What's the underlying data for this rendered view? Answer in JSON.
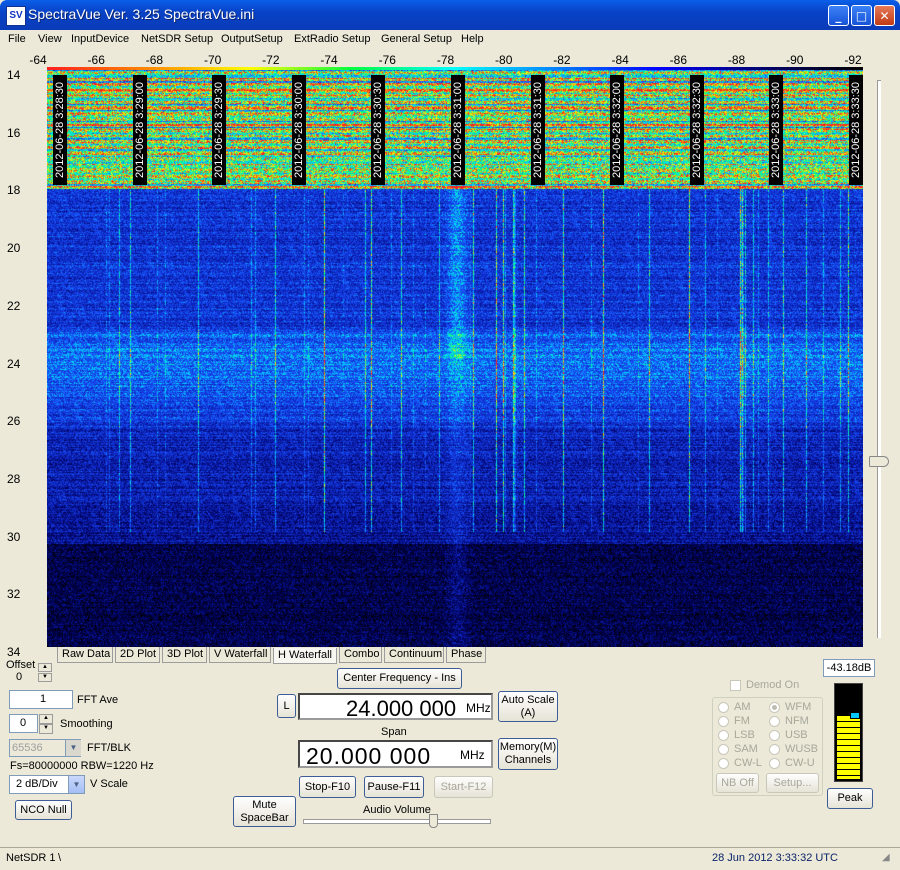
{
  "window": {
    "title": "SpectraVue Ver. 3.25  SpectraVue.ini",
    "icon_text": "SV",
    "controls": {
      "minimize": "_",
      "maximize": "□",
      "close": "✕"
    }
  },
  "menu": [
    "File",
    "View",
    "InputDevice",
    "NetSDR Setup",
    "OutputSetup",
    "ExtRadio Setup",
    "General Setup",
    "Help"
  ],
  "waterfall": {
    "x_ticks": [
      "-64",
      "-66",
      "-68",
      "-70",
      "-72",
      "-74",
      "-76",
      "-78",
      "-80",
      "-82",
      "-84",
      "-86",
      "-88",
      "-90",
      "-92"
    ],
    "y_ticks": [
      "14",
      "16",
      "18",
      "20",
      "22",
      "24",
      "26",
      "28",
      "30",
      "32",
      "34"
    ],
    "timestamps": [
      "2012-06-28 3:28:30",
      "2012-06-28 3:29:00",
      "2012-06-28 3:29:30",
      "2012-06-28 3:30:00",
      "2012-06-28 3:30:30",
      "2012-06-28 3:31:00",
      "2012-06-28 3:31:30",
      "2012-06-28 3:32:00",
      "2012-06-28 3:32:30",
      "2012-06-28 3:33:00",
      "2012-06-28 3:33:30"
    ],
    "colors": {
      "background": "#0A1E8C",
      "hot": "#FF2020",
      "warm": "#FFE000",
      "mid": "#00E6FF"
    }
  },
  "tabs": [
    "Raw Data",
    "2D Plot",
    "3D Plot",
    "V Waterfall",
    "H Waterfall",
    "Combo",
    "Continuum",
    "Phase"
  ],
  "active_tab": "H Waterfall",
  "left_panel": {
    "offset_label": "Offset",
    "offset_value": "0",
    "fft_ave_value": "1",
    "fft_ave_label": "FFT Ave",
    "smoothing_value": "0",
    "smoothing_label": "Smoothing",
    "fft_blk_value": "65536",
    "fft_blk_label": "FFT/BLK",
    "fs_rbw": "Fs=80000000 RBW=1220 Hz",
    "vscale_value": "2 dB/Div",
    "vscale_label": "V Scale",
    "nco_null": "NCO Null"
  },
  "center_panel": {
    "center_freq_button": "Center Frequency - Ins",
    "l_button": "L",
    "center_freq_value": "24.000 000",
    "center_freq_unit": "MHz",
    "auto_scale": "Auto Scale\n(A)",
    "span_label": "Span",
    "span_value": "20.000 000",
    "span_unit": "MHz",
    "memory_channels": "Memory(M)\nChannels",
    "mute": "Mute\nSpaceBar",
    "stop": "Stop-F10",
    "pause": "Pause-F11",
    "start": "Start-F12",
    "audio_volume_label": "Audio Volume",
    "audio_volume_level": 0.7
  },
  "demod_panel": {
    "demod_on_label": "Demod On",
    "modes_left": [
      "AM",
      "FM",
      "LSB",
      "SAM",
      "CW-L"
    ],
    "modes_right": [
      "WFM",
      "NFM",
      "USB",
      "WUSB",
      "CW-U"
    ],
    "selected_mode": "WFM",
    "nb_off": "NB Off",
    "setup": "Setup..."
  },
  "meter": {
    "level_text": "-43.18dB",
    "peak": "Peak",
    "colors": {
      "bar": "#FFFF00",
      "marker": "#00C8FF"
    }
  },
  "status": {
    "left": "NetSDR 1",
    "separator": "\\",
    "datetime": "28 Jun 2012   3:33:32 UTC"
  }
}
